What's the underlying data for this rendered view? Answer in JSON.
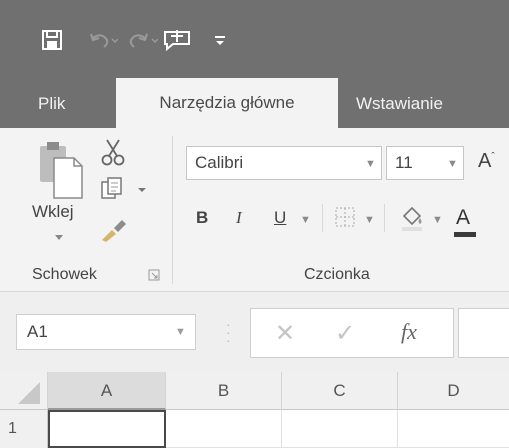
{
  "qat": {
    "icons": [
      "save-icon",
      "undo-icon",
      "redo-icon",
      "touch-mode-icon",
      "customize-qat-icon"
    ]
  },
  "tabs": [
    {
      "label": "Plik"
    },
    {
      "label": "Narzędzia główne",
      "active": true
    },
    {
      "label": "Wstawianie"
    }
  ],
  "clipboard": {
    "paste_label": "Wklej",
    "group_label": "Schowek"
  },
  "font": {
    "name": "Calibri",
    "size": "11",
    "bold": "B",
    "italic": "I",
    "underline": "U",
    "grow": "A",
    "color_letter": "A",
    "group_label": "Czcionka"
  },
  "formula_bar": {
    "name_box": "A1",
    "fx": "fx"
  },
  "grid": {
    "columns": [
      "A",
      "B",
      "C",
      "D"
    ],
    "rows": [
      "1"
    ],
    "selected_cell": "A1"
  },
  "colors": {
    "title_bar": "#707070",
    "ribbon": "#f3f3f3",
    "font_color_bar": "#3a3a3a"
  }
}
